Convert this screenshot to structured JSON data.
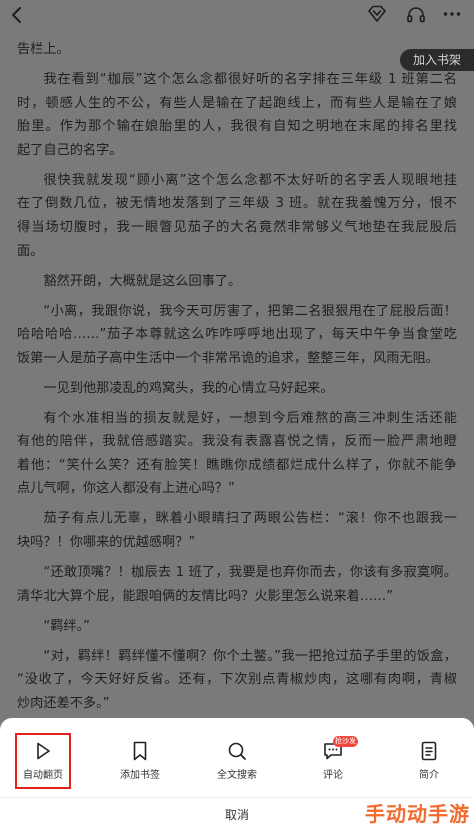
{
  "colors": {
    "page_bg": "#7a7a7a",
    "text": "#1f1f1f",
    "sheet_bg": "#ffffff",
    "highlight_red": "#e3201b",
    "badge_red": "#f0483e",
    "watermark": "#f26a2e"
  },
  "top_bar": {
    "back_icon": "chevron-left-icon",
    "right_icons": [
      "vip-diamond-icon",
      "headphones-icon",
      "more-icon"
    ]
  },
  "add_to_shelf": {
    "label": "加入书架"
  },
  "reader": {
    "paragraphs": [
      [
        "告栏上。"
      ],
      [
        "我在看到“枷辰”这个怎么念都很好听的名字排在三年级 1 班第二名",
        "时，顿感人生的不公，有些人是输在了起跑线上，而有些人是输在了娘",
        "胎里。作为那个输在娘胎里的人，我很有自知之明地在末尾的排名里找",
        "起了自己的名字。"
      ],
      [
        "很快我就发现“顾小离”这个怎么念都不太好听的名字丢人现眼地挂",
        "在了倒数几位，被无情地发落到了三年级 3 班。就在我羞愧万分，恨不",
        "得当场切腹时，我一眼瞥见茄子的大名竟然非常够义气地垫在我屁股后",
        "面。"
      ],
      [
        "豁然开朗，大概就是这么回事了。"
      ],
      [
        "“小离，我跟你说，我今天可厉害了，把第二名狠狠甩在了屁股后面！",
        "哈哈哈哈……”茄子本尊就这么咋咋呼呼地出现了，每天中午争当食堂吃",
        "饭第一人是茄子高中生活中一个非常吊诡的追求，整整三年，风雨无阻。"
      ],
      [
        "一见到他那凌乱的鸡窝头，我的心情立马好起来。"
      ],
      [
        "有个水准相当的损友就是好，一想到今后难熬的高三冲刺生活还能",
        "有他的陪伴，我就倍感踏实。我没有表露喜悦之情，反而一脸严肃地瞪",
        "着他：“笑什么笑？还有脸笑！瞧瞧你成绩都烂成什么样了，你就不能争",
        "点儿气啊，你这人都没有上进心吗？”"
      ],
      [
        "茄子有点儿无辜，眯着小眼睛扫了两眼公告栏：“滚！你不也跟我一",
        "块吗？！你哪来的优越感啊？”"
      ],
      [
        "“还敢顶嘴？！枷辰去 1 班了，我要是也弃你而去，你该有多寂寞啊。",
        "清华北大算个屁，能跟咱俩的友情比吗？火影里怎么说来着……”"
      ],
      [
        "“羁绊。”"
      ],
      [
        "“对，羁绊！羁绊懂不懂啊？你个土鳖。”我一把抢过茄子手里的饭盒，",
        "“没收了，今天好好反省。还有，下次别点青椒炒肉，这哪有肉啊，青椒",
        "炒肉还差不多。”"
      ]
    ]
  },
  "bottom_menu": {
    "items": [
      {
        "label": "自动翻页",
        "icon": "play-icon",
        "highlighted": true
      },
      {
        "label": "添加书签",
        "icon": "bookmark-icon"
      },
      {
        "label": "全文搜索",
        "icon": "search-icon"
      },
      {
        "label": "评论",
        "icon": "comment-icon",
        "badge": "抢沙发"
      },
      {
        "label": "简介",
        "icon": "document-icon"
      }
    ],
    "cancel_label": "取消"
  },
  "watermark": "手动动手游"
}
